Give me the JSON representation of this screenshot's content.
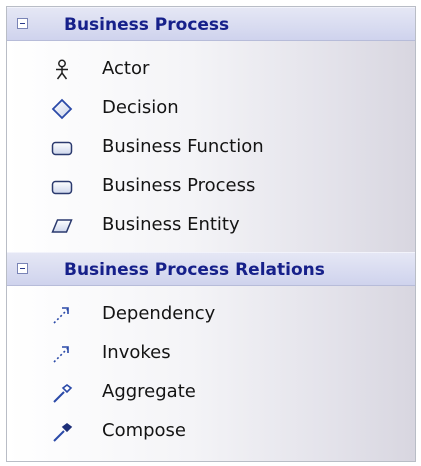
{
  "sections": [
    {
      "title": "Business Process",
      "items": [
        {
          "label": "Actor",
          "icon": "actor-icon"
        },
        {
          "label": "Decision",
          "icon": "decision-icon"
        },
        {
          "label": "Business Function",
          "icon": "rounded-rectangle-icon"
        },
        {
          "label": "Business Process",
          "icon": "rounded-rectangle-icon"
        },
        {
          "label": "Business Entity",
          "icon": "parallelogram-icon"
        }
      ]
    },
    {
      "title": "Business Process Relations",
      "items": [
        {
          "label": "Dependency",
          "icon": "dotted-arrow-icon"
        },
        {
          "label": "Invokes",
          "icon": "dotted-arrow-icon"
        },
        {
          "label": "Aggregate",
          "icon": "hollow-diamond-line-icon"
        },
        {
          "label": "Compose",
          "icon": "filled-diamond-line-icon"
        }
      ]
    }
  ],
  "colors": {
    "header_text": "#16208a",
    "icon_blue": "#2b4aa8"
  }
}
